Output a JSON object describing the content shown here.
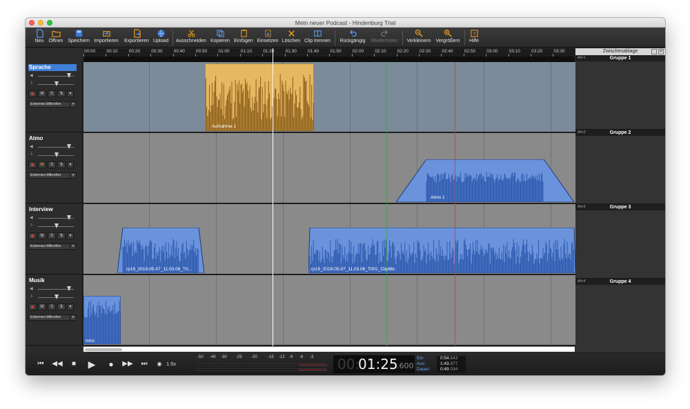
{
  "window": {
    "title": "Mein neuer Podcast - Hindenburg Trial"
  },
  "toolbar": {
    "neu": "Neu",
    "oeffnen": "Öffnen",
    "speichern": "Speichern",
    "importieren": "Importieren",
    "exportieren": "Exportieren",
    "upload": "Upload",
    "ausschneiden": "Ausschneiden",
    "kopieren": "Kopieren",
    "einfuegen": "Einfügen",
    "einsetzen": "Einsetzen",
    "loeschen": "Löschen",
    "clip_trennen": "Clip trennen",
    "rueckgaengig": "Rückgängig",
    "wiederholen": "Wiederholen",
    "verkleinern": "Verkleinern",
    "vergroessern": "Vergrößern",
    "hilfe": "Hilfe"
  },
  "ruler": {
    "ticks": [
      "00:00",
      "00:10",
      "00:20",
      "00:30",
      "00:40",
      "00:50",
      "01:00",
      "01:10",
      "01:20",
      "01:30",
      "01:40",
      "01:50",
      "02:00",
      "02:10",
      "02:20",
      "02:30",
      "02:40",
      "02:50",
      "03:00",
      "03:10",
      "03:20",
      "03:30"
    ]
  },
  "tracks": [
    {
      "name": "Sprache",
      "input": "Externes Mikrofon",
      "clips": [
        "Aufnahme 1"
      ]
    },
    {
      "name": "Atmo",
      "input": "Externes Mikrofon",
      "clips": [
        "Atmo 1"
      ]
    },
    {
      "name": "Interview",
      "input": "Externes Mikrofon",
      "clips": [
        "rp19_2019-05-07_11.03.06_T0...",
        "rp19_2019-05-07_11.03.06_T001_ClipMic"
      ]
    },
    {
      "name": "Musik",
      "input": "Externes Mikrofon",
      "clips": [
        "Intro"
      ]
    }
  ],
  "track_buttons": {
    "mute": "M",
    "solo": "S",
    "fx": "⇅"
  },
  "clipboard": {
    "title": "Zwischenablage",
    "groups": [
      {
        "label": "Gruppe 1",
        "shortcut": "Alt+1"
      },
      {
        "label": "Gruppe 2",
        "shortcut": "Alt+2"
      },
      {
        "label": "Gruppe 3",
        "shortcut": "Alt+3"
      },
      {
        "label": "Gruppe 4",
        "shortcut": "Alt+4"
      }
    ]
  },
  "transport": {
    "speed": "1.5x",
    "vu_scale": [
      "-50",
      "-40",
      "-30",
      "-25",
      "-20",
      "-15",
      "-12",
      "-9",
      "-6",
      "-3"
    ],
    "timecode_dim": "00:",
    "timecode_main": "01:25",
    "timecode_ms": ".600",
    "ein_label": "Ein:",
    "ein_value": "0:54",
    "ein_ms": ".843",
    "aus_label": "Aus:",
    "aus_value": "1:43",
    "aus_ms": ".877",
    "dauer_label": "Dauer:",
    "dauer_value": "0:49",
    "dauer_ms": ".034"
  },
  "colors": {
    "speech_clip": "#c8953a",
    "audio_clip": "#3b66b8",
    "selected_track": "#3f7fd6"
  },
  "icons": [
    "new-file-icon",
    "open-folder-icon",
    "save-icon",
    "import-icon",
    "export-icon",
    "upload-globe-icon",
    "scissors-icon",
    "copy-icon",
    "paste-icon",
    "insert-icon",
    "delete-icon",
    "split-clip-icon",
    "undo-icon",
    "redo-icon",
    "zoom-out-icon",
    "zoom-in-icon",
    "help-icon"
  ]
}
